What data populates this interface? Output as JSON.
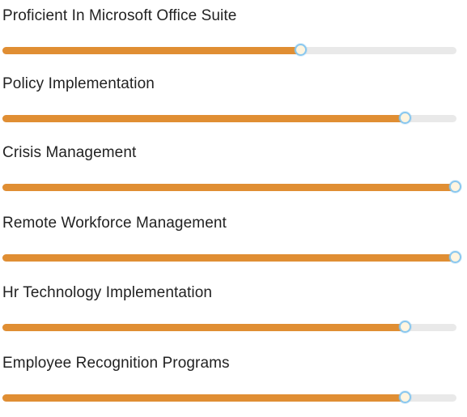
{
  "skills": [
    {
      "label": "Proficient In Microsoft Office Suite",
      "level_percent": 66
    },
    {
      "label": "Policy Implementation",
      "level_percent": 89
    },
    {
      "label": "Crisis Management",
      "level_percent": 100
    },
    {
      "label": "Remote Workforce Management",
      "level_percent": 100
    },
    {
      "label": "Hr Technology Implementation",
      "level_percent": 89
    },
    {
      "label": "Employee Recognition Programs",
      "level_percent": 89
    }
  ],
  "colors": {
    "fill": "#e08e33",
    "track": "#e9e9e9",
    "thumb_border": "#88c7ef",
    "thumb_fill": "#fff5e0",
    "text": "#222222"
  }
}
